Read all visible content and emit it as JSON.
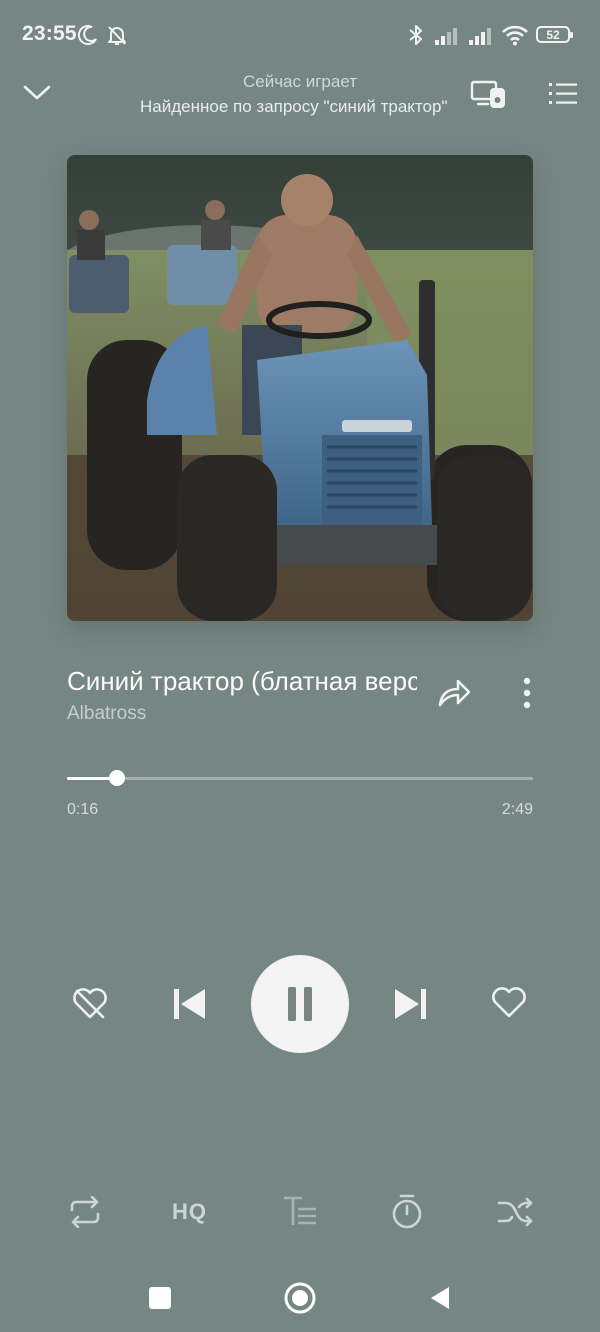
{
  "status_bar": {
    "time": "23:55",
    "battery": "52",
    "icons": [
      "moon-icon",
      "bell-off-icon",
      "bluetooth-icon",
      "signal-icon",
      "signal-icon",
      "wifi-icon",
      "battery-icon"
    ]
  },
  "header": {
    "subtitle": "Сейчас играет",
    "title": "Найденное по запросу \"синий трактор\""
  },
  "track": {
    "title": "Синий трактор (блатная версия)",
    "artist": "Albatross",
    "current_time": "0:16",
    "total_time": "2:49",
    "progress": 0.107
  },
  "bottom_bar": {
    "quality_label": "HQ"
  },
  "colors": {
    "background": "#768683",
    "accent": "#ffffff"
  }
}
